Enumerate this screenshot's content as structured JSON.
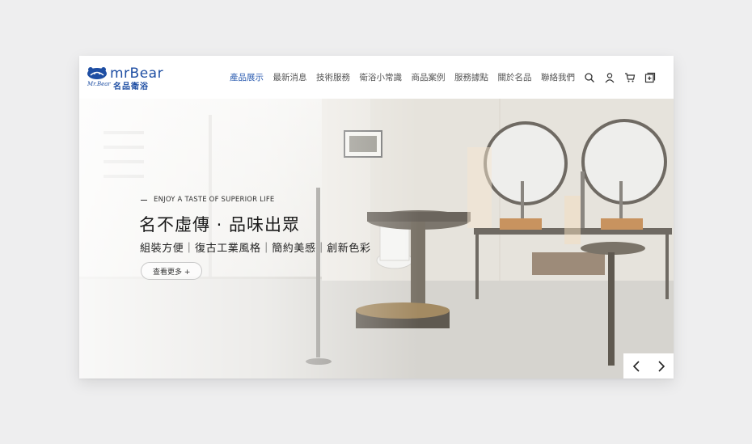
{
  "brand": {
    "name_en": "mrBear",
    "name_zh": "名品衛浴",
    "tagline_script": "Mr.Bear",
    "color": "#1e4ea3"
  },
  "nav": {
    "items": [
      {
        "label": "產品展示",
        "active": true
      },
      {
        "label": "最新消息",
        "active": false
      },
      {
        "label": "技術服務",
        "active": false
      },
      {
        "label": "衛浴小常識",
        "active": false
      },
      {
        "label": "商品案例",
        "active": false
      },
      {
        "label": "服務據點",
        "active": false
      },
      {
        "label": "關於名品",
        "active": false
      },
      {
        "label": "聯絡我們",
        "active": false
      }
    ],
    "icons": [
      "search-icon",
      "user-icon",
      "cart-icon",
      "add-square-icon"
    ],
    "active_color": "#2a5bb0"
  },
  "hero": {
    "eyebrow": "ENJOY A TASTE OF SUPERIOR LIFE",
    "headline": "名不虛傳 · 品味出眾",
    "subline": "組裝方便｜復古工業風格｜簡約美感｜創新色彩",
    "cta": "查看更多 +",
    "prev_icon": "chevron-left-icon",
    "next_icon": "chevron-right-icon"
  }
}
